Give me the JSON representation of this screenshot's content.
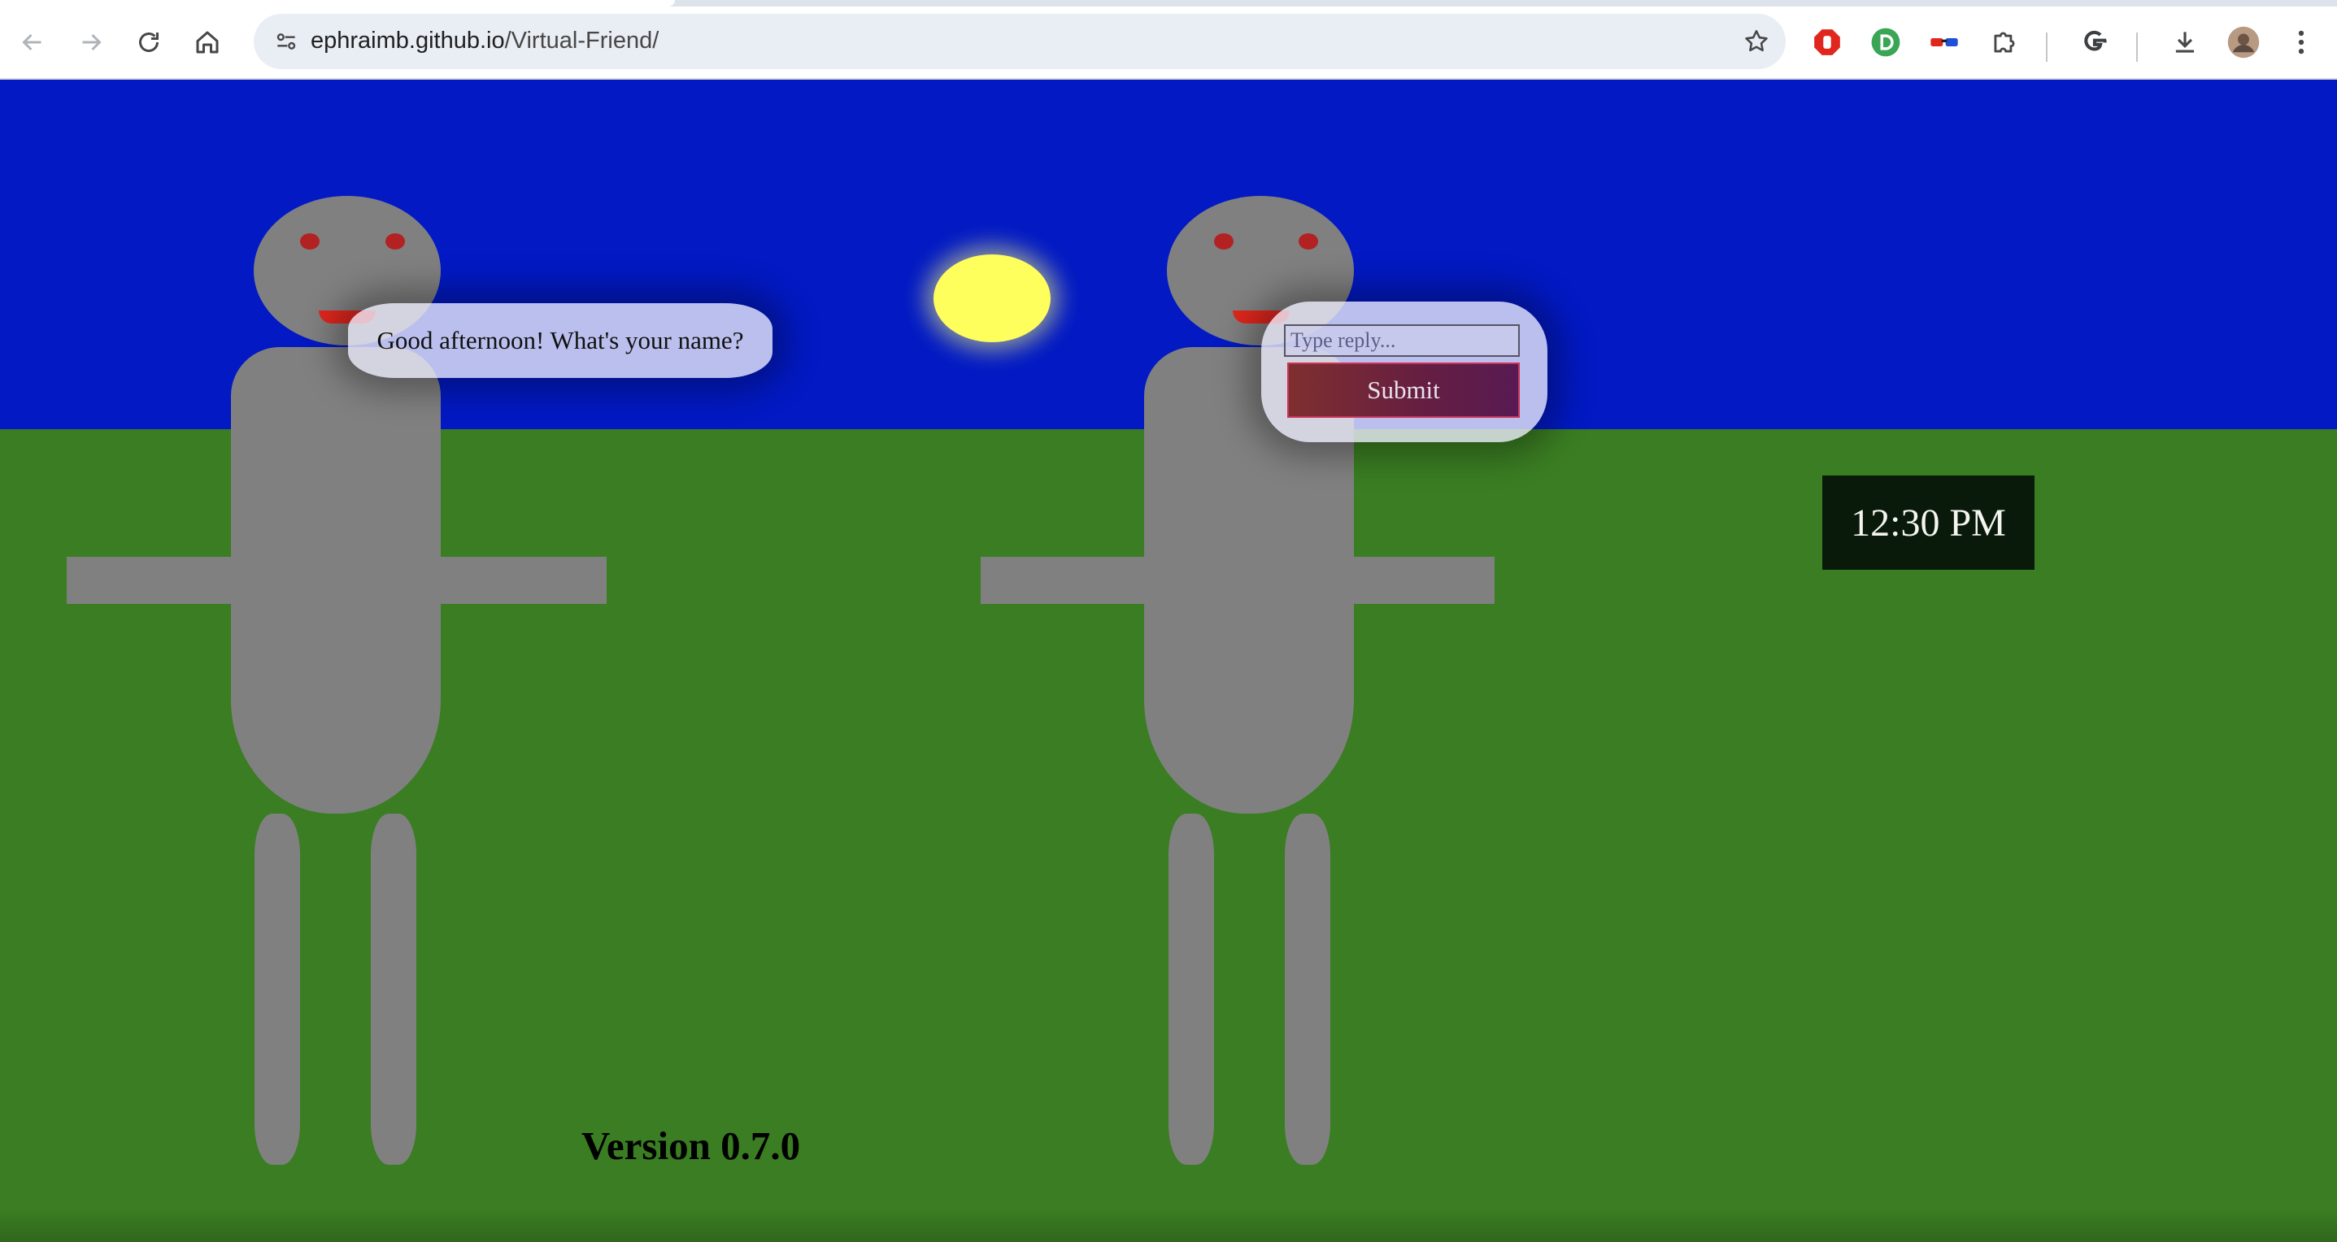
{
  "browser": {
    "url_host": "ephraimb.github.io",
    "url_path": "/Virtual-Friend/",
    "nav_icons": [
      "back-icon",
      "forward-icon",
      "reload-icon",
      "home-icon"
    ],
    "extension_icons": [
      "stop-hand-extension-icon",
      "green-d-extension-icon",
      "3d-glasses-extension-icon",
      "puzzle-extensions-icon",
      "google-icon",
      "download-icon",
      "profile-avatar",
      "more-menu-icon"
    ]
  },
  "scene": {
    "sky_color": "#0219c4",
    "grass_color": "#3a7d22",
    "sun_color": "#fefe5c",
    "robot_color": "#808080",
    "eye_color": "#b22222",
    "mouth_color": "#e0261d"
  },
  "speech_bubble": {
    "text": "Good afternoon! What's your name?"
  },
  "reply": {
    "placeholder": "Type reply...",
    "value": "",
    "submit_label": "Submit"
  },
  "clock": {
    "time": "12:30 PM"
  },
  "footer": {
    "version": "Version 0.7.0"
  }
}
